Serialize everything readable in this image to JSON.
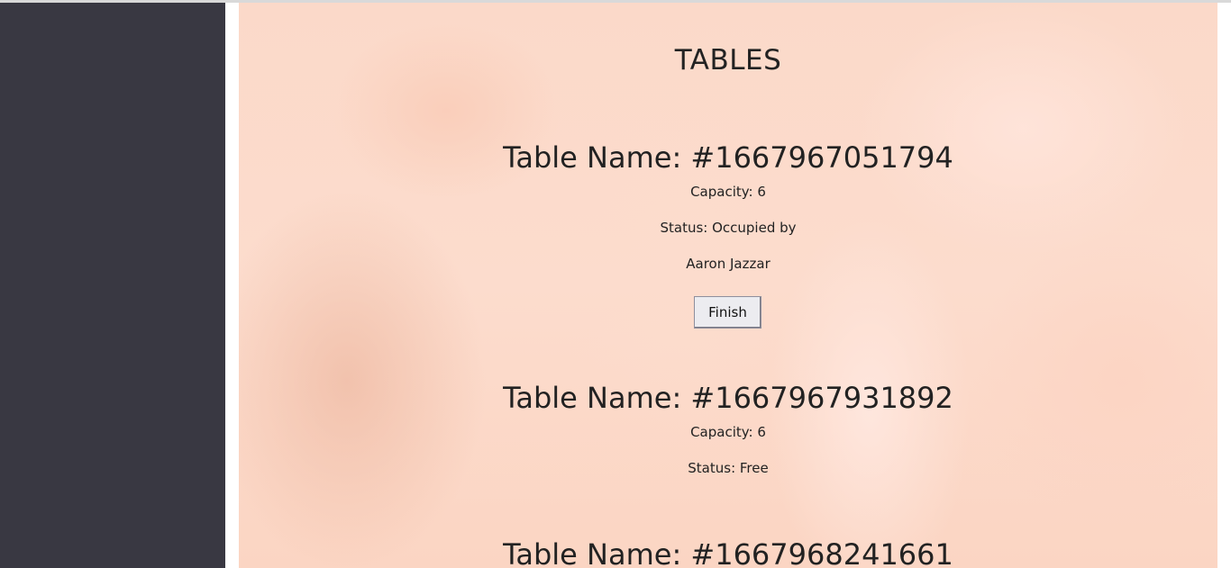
{
  "page": {
    "title": "TABLES"
  },
  "tables": [
    {
      "name": "Table Name: #1667967051794",
      "capacity": "Capacity: 6",
      "status": "Status: Occupied by",
      "occupant": "Aaron Jazzar",
      "action_label": "Finish"
    },
    {
      "name": "Table Name: #1667967931892",
      "capacity": "Capacity: 6",
      "status": "Status: Free"
    },
    {
      "name": "Table Name: #1667968241661"
    }
  ],
  "colors": {
    "sidebar": "#393842",
    "background_tint": "#fbd9c9",
    "text": "#222222",
    "button_bg": "#ececf0"
  }
}
